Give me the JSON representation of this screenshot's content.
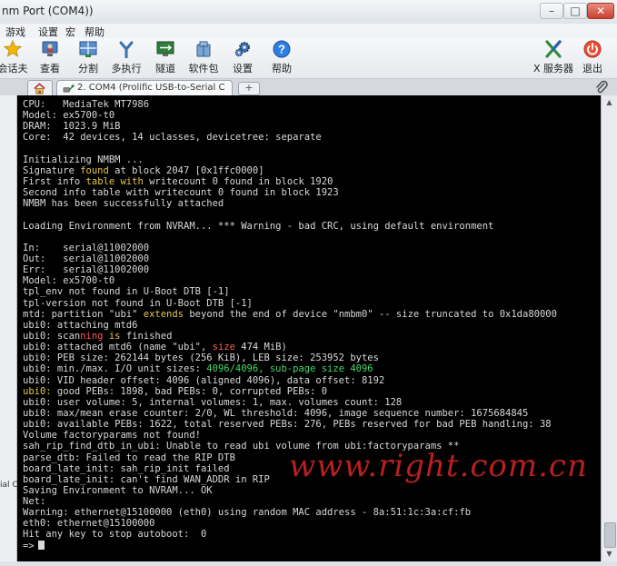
{
  "window": {
    "title": "nm Port (COM4))",
    "controls": {
      "minimize": "–",
      "maximize": "□",
      "close": "✕"
    }
  },
  "menu": [
    "游戏",
    "设置",
    "宏",
    "帮助"
  ],
  "toolbar": {
    "left_items": [
      {
        "label": "会话夫",
        "icon": "star-icon"
      },
      {
        "label": "查看",
        "icon": "monitor-user-icon"
      },
      {
        "label": "分割",
        "icon": "split-windows-icon"
      },
      {
        "label": "多执行",
        "icon": "fork-icon"
      },
      {
        "label": "隧道",
        "icon": "tunnel-monitor-icon"
      },
      {
        "label": "软件包",
        "icon": "package-icon"
      },
      {
        "label": "设置",
        "icon": "gears-icon"
      },
      {
        "label": "帮助",
        "icon": "help-icon"
      }
    ],
    "right_items": [
      {
        "label": "X 服务器",
        "icon": "x-server-icon"
      },
      {
        "label": "退出",
        "icon": "power-icon"
      }
    ]
  },
  "tabs": {
    "home_icon": "home-icon",
    "session_tab_label": "2. COM4 (Prolific USB-to-Serial C",
    "new_tab_symbol": "+"
  },
  "sidepanel": {
    "partial_text": "ial Co"
  },
  "terminal": {
    "lines": [
      [
        {
          "t": "CPU:   MediaTek MT7986"
        }
      ],
      [
        {
          "t": "Model: ex5700-t0"
        }
      ],
      [
        {
          "t": "DRAM:  1023.9 MiB"
        }
      ],
      [
        {
          "t": "Core:  42 devices, 14 uclasses, devicetree: separate"
        }
      ],
      [
        {
          "t": ""
        }
      ],
      [
        {
          "t": "Initializing NMBM ..."
        }
      ],
      [
        {
          "t": "Signature "
        },
        {
          "t": "found",
          "c": "yellow"
        },
        {
          "t": " at block 2047 [0x1ffc0000]"
        }
      ],
      [
        {
          "t": "First info "
        },
        {
          "t": "table",
          "c": "yellow"
        },
        {
          "t": " "
        },
        {
          "t": "with",
          "c": "yellow"
        },
        {
          "t": " writecount 0 found in block 1920"
        }
      ],
      [
        {
          "t": "Second info table with writecount 0 found in block 1923"
        }
      ],
      [
        {
          "t": "NMBM has been successfully attached"
        }
      ],
      [
        {
          "t": ""
        }
      ],
      [
        {
          "t": "Loading Environment from NVRAM... *** Warning - bad CRC, using default environment"
        }
      ],
      [
        {
          "t": ""
        }
      ],
      [
        {
          "t": "In:    serial@11002000"
        }
      ],
      [
        {
          "t": "Out:   serial@11002000"
        }
      ],
      [
        {
          "t": "Err:   serial@11002000"
        }
      ],
      [
        {
          "t": "Model: ex5700-t0"
        }
      ],
      [
        {
          "t": "tpl_env not found in U-Boot DTB [-1]"
        }
      ],
      [
        {
          "t": "tpl-version not found in U-Boot DTB [-1]"
        }
      ],
      [
        {
          "t": "mtd: partition \"ubi\" "
        },
        {
          "t": "extends",
          "c": "yellow"
        },
        {
          "t": " beyond the end of device \"nmbm0\" -- size truncated to 0x1da80000"
        }
      ],
      [
        {
          "t": "ubi0: attaching mtd6"
        }
      ],
      [
        {
          "t": "ubi0: scan"
        },
        {
          "t": "ning",
          "c": "red"
        },
        {
          "t": " "
        },
        {
          "t": "is",
          "c": "yellow"
        },
        {
          "t": " finished"
        }
      ],
      [
        {
          "t": "ubi0: attached mtd6 (name \"ubi\", "
        },
        {
          "t": "size",
          "c": "red"
        },
        {
          "t": " 474 MiB)"
        }
      ],
      [
        {
          "t": "ubi0: PEB size: 262144 bytes (256 KiB), LEB size: 253952 bytes"
        }
      ],
      [
        {
          "t": "ubi0: min./max. I/O unit sizes: "
        },
        {
          "t": "4096/4096, sub-page size 4096",
          "c": "green"
        }
      ],
      [
        {
          "t": "ubi0: VID header offset: 4096 (aligned 4096), data offset: 8192"
        }
      ],
      [
        {
          "t": "ubi0:",
          "c": "yellow"
        },
        {
          "t": " good PEBs: 1898, bad PEBs: 0, corrupted PEBs: 0"
        }
      ],
      [
        {
          "t": "ubi0: user volume: 5, internal volumes: 1, max. volumes count: 128"
        }
      ],
      [
        {
          "t": "ubi0: max/mean erase counter: 2/0, WL threshold: 4096, image sequence number: 1675684845"
        }
      ],
      [
        {
          "t": "ubi0: available PEBs: 1622, total reserved PEBs: 276, PEBs reserved for bad PEB handling: 38"
        }
      ],
      [
        {
          "t": "Volume factoryparams not found!"
        }
      ],
      [
        {
          "t": "sah_rip_find_dtb_in_ubi: Unable to read ubi volume from ubi:factoryparams **"
        }
      ],
      [
        {
          "t": "parse_dtb: Failed to read the RIP DTB"
        }
      ],
      [
        {
          "t": "board_late_init: sah_rip_init failed"
        }
      ],
      [
        {
          "t": "board_late_init: can't find WAN_ADDR in RIP"
        }
      ],
      [
        {
          "t": "Saving Environment to NVRAM... OK"
        }
      ],
      [
        {
          "t": "Net:"
        }
      ],
      [
        {
          "t": "Warning: ethernet@15100000 (eth0) using random MAC address - 8a:51:1c:3a:cf:fb"
        }
      ],
      [
        {
          "t": "eth0: ethernet@15100000"
        }
      ],
      [
        {
          "t": "Hit any key to stop autoboot:  0"
        }
      ],
      [
        {
          "t": "=>"
        }
      ]
    ]
  },
  "watermark": "www.right.com.cn",
  "colors": {
    "terminal_bg": "#000000",
    "terminal_fg": "#d9d9d9",
    "highlight_yellow": "#e6c84a",
    "highlight_green": "#45d86a",
    "highlight_red": "#ff5a5a",
    "watermark_red": "#e62828"
  }
}
